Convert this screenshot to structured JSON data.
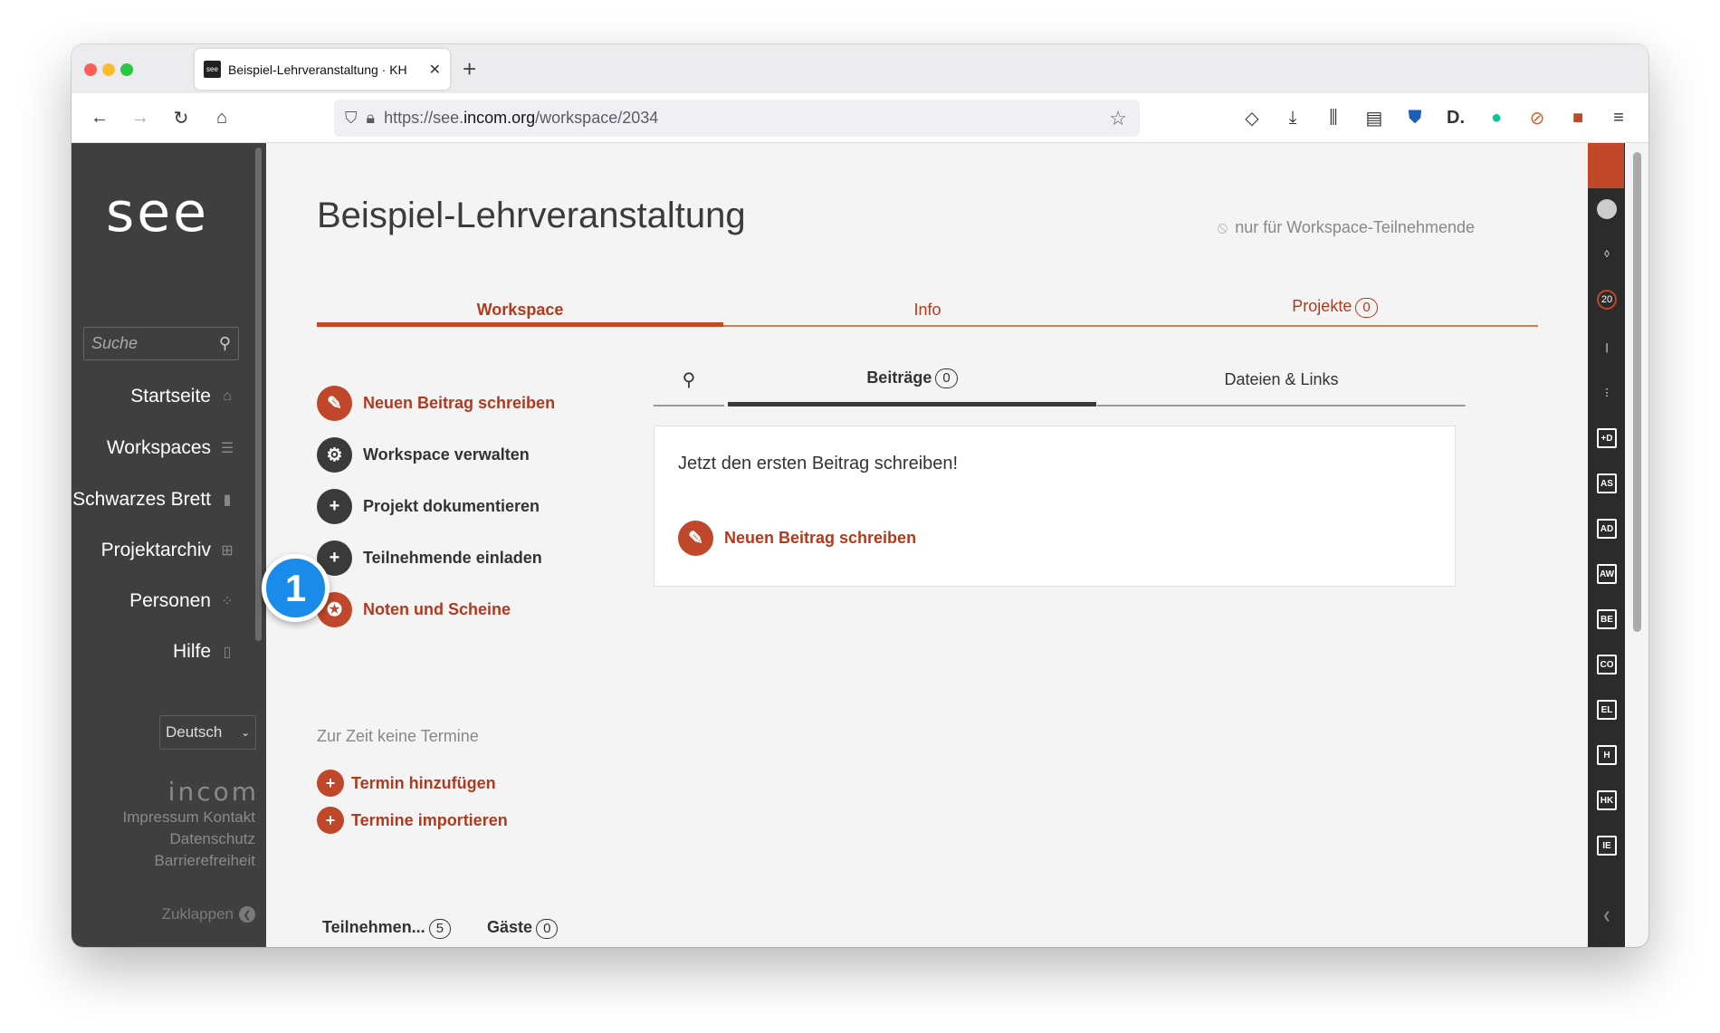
{
  "browser": {
    "tab_title": "Beispiel-Lehrveranstaltung · KH",
    "favicon_text": "see",
    "url_prefix": "https://see.",
    "url_domain": "incom.org",
    "url_path": "/workspace/2034",
    "icons": [
      "back-icon",
      "forward-icon",
      "reload-icon",
      "home-icon",
      "shield-icon",
      "lock-icon",
      "star-icon",
      "pocket-icon",
      "download-icon",
      "library-icon",
      "reader-icon",
      "extension-icon",
      "menu-icon"
    ]
  },
  "sidebar": {
    "logo": "see",
    "search_placeholder": "Suche",
    "items": [
      {
        "label": "Startseite",
        "icon": "home-icon"
      },
      {
        "label": "Workspaces",
        "icon": "list-icon"
      },
      {
        "label": "Schwarzes Brett",
        "icon": "clipboard-icon"
      },
      {
        "label": "Projektarchiv",
        "icon": "grid-icon"
      },
      {
        "label": "Personen",
        "icon": "people-icon"
      },
      {
        "label": "Hilfe",
        "icon": "book-icon"
      }
    ],
    "language": "Deutsch",
    "brand": "incom",
    "footer_line1": "Impressum Kontakt",
    "footer_line2": "Datenschutz",
    "footer_line3": "Barrierefreiheit",
    "collapse": "Zuklappen"
  },
  "main": {
    "title": "Beispiel-Lehrveranstaltung",
    "visibility": "nur für Workspace-Teilnehmende",
    "tabs": [
      {
        "label": "Workspace",
        "count": null
      },
      {
        "label": "Info",
        "count": null
      },
      {
        "label": "Projekte",
        "count": "0"
      }
    ],
    "actions": [
      {
        "label": "Neuen Beitrag schreiben"
      },
      {
        "label": "Workspace verwalten"
      },
      {
        "label": "Projekt dokumentieren"
      },
      {
        "label": "Teilnehmende einladen"
      },
      {
        "label": "Noten und Scheine"
      }
    ],
    "badge": "1",
    "termine_empty": "Zur Zeit keine Termine",
    "termin_add": "Termin hinzufügen",
    "termin_import": "Termine importieren",
    "post_tabs": [
      {
        "label": "Beiträge",
        "count": "0"
      },
      {
        "label": "Dateien & Links"
      }
    ],
    "card_text": "Jetzt den ersten Beitrag schreiben!",
    "card_button": "Neuen Beitrag schreiben",
    "bottom_tabs": [
      {
        "label": "Teilnehmen...",
        "count": "5"
      },
      {
        "label": "Gäste",
        "count": "0"
      }
    ]
  },
  "rightbar": {
    "items": [
      "20",
      "+D",
      "AS",
      "AD",
      "AW",
      "BE",
      "CO",
      "EL",
      "H",
      "HK",
      "IE"
    ]
  },
  "colors": {
    "accent": "#c0472a",
    "sidebar": "#3f3f3f",
    "badge": "#1b8bea"
  }
}
